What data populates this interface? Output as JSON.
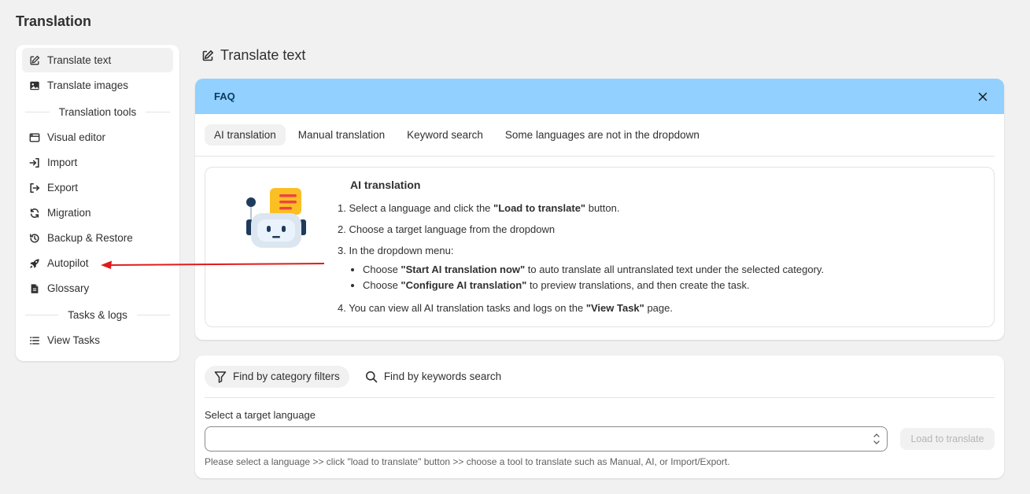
{
  "page": {
    "title": "Translation"
  },
  "sidebar": {
    "items_top": [
      {
        "label": "Translate text",
        "icon": "edit-icon",
        "active": true
      },
      {
        "label": "Translate images",
        "icon": "image-icon",
        "active": false
      }
    ],
    "section_tools": "Translation tools",
    "items_tools": [
      {
        "label": "Visual editor",
        "icon": "browser-window-icon"
      },
      {
        "label": "Import",
        "icon": "import-icon"
      },
      {
        "label": "Export",
        "icon": "export-icon"
      },
      {
        "label": "Migration",
        "icon": "refresh-icon"
      },
      {
        "label": "Backup & Restore",
        "icon": "history-icon"
      },
      {
        "label": "Autopilot",
        "icon": "rocket-icon"
      },
      {
        "label": "Glossary",
        "icon": "document-icon"
      }
    ],
    "section_tasks": "Tasks & logs",
    "items_tasks": [
      {
        "label": "View Tasks",
        "icon": "list-icon"
      }
    ]
  },
  "main": {
    "title": "Translate text",
    "faq": {
      "title": "FAQ",
      "tabs": [
        "AI translation",
        "Manual translation",
        "Keyword search",
        "Some languages are not in the dropdown"
      ],
      "active_tab": 0,
      "content": {
        "heading": "AI translation",
        "step1_pre": "1. Select a language and click the ",
        "step1_bold": "\"Load to translate\"",
        "step1_post": " button.",
        "step2": "2. Choose a target language from the dropdown",
        "step3": "3. In the dropdown menu:",
        "sub1_pre": "Choose ",
        "sub1_bold": "\"Start AI translation now\"",
        "sub1_post": " to auto translate all untranslated text under the selected category.",
        "sub2_pre": "Choose ",
        "sub2_bold": "\"Configure AI translation\"",
        "sub2_post": " to preview translations, and then create the task.",
        "step4_pre": "4. You can view all AI translation tasks and logs on the ",
        "step4_bold": "\"View Task\"",
        "step4_post": " page."
      }
    },
    "filters": {
      "tabs": [
        "Find by category filters",
        "Find by keywords search"
      ],
      "select_label": "Select a target language",
      "select_value": "",
      "load_button": "Load to translate",
      "help": "Please select a language >> click \"load to translate\" button >> choose a tool to translate such as Manual, AI, or Import/Export."
    }
  },
  "colors": {
    "faq_banner": "#91d0ff",
    "arrow": "#e01b1b",
    "background": "#f1f1f1"
  }
}
